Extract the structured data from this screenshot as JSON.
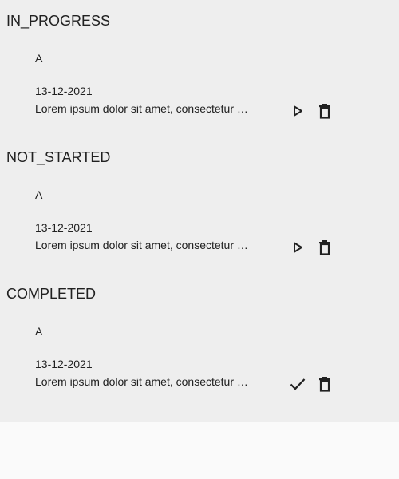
{
  "sections": [
    {
      "title": "IN_PROGRESS",
      "task": {
        "title": "A",
        "date": "13-12-2021",
        "description": "Lorem ipsum dolor sit amet, consectetur adipiscing elit",
        "action_icon": "play-icon",
        "delete_icon": "trash-icon"
      }
    },
    {
      "title": "NOT_STARTED",
      "task": {
        "title": "A",
        "date": "13-12-2021",
        "description": "Lorem ipsum dolor sit amet, consectetur adipiscing elit",
        "action_icon": "play-icon",
        "delete_icon": "trash-icon"
      }
    },
    {
      "title": "COMPLETED",
      "task": {
        "title": "A",
        "date": "13-12-2021",
        "description": "Lorem ipsum dolor sit amet, consectetur adipiscing elit",
        "action_icon": "check-icon",
        "delete_icon": "trash-icon"
      }
    }
  ],
  "colors": {
    "panel_background": "#eeeeee",
    "page_background": "#fafafa",
    "text": "#212121"
  }
}
